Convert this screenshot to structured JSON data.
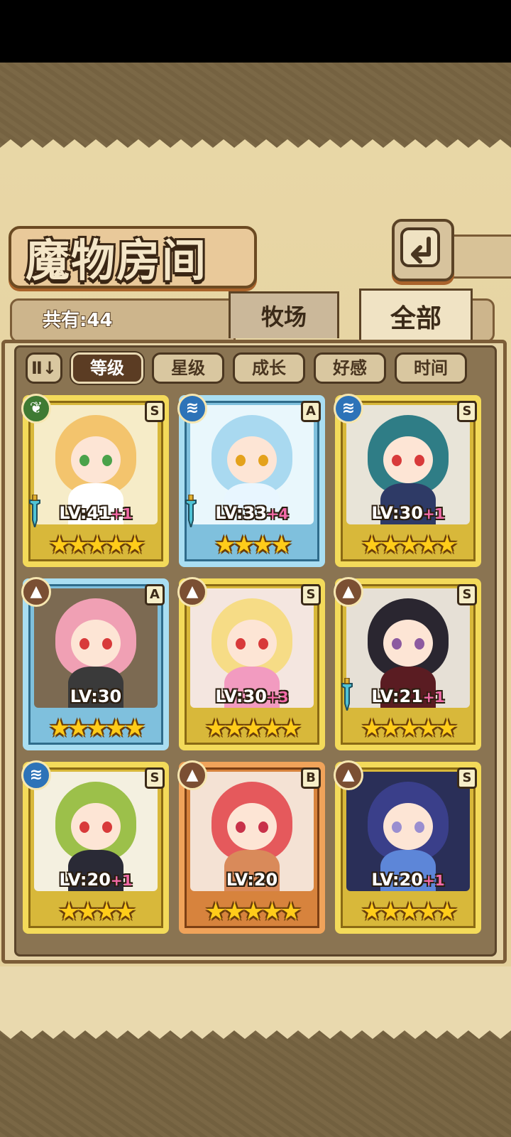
{
  "header": {
    "title": "魔物房间"
  },
  "info": {
    "count_label": "共有:44"
  },
  "tabs": [
    {
      "label": "牧场",
      "active": false
    },
    {
      "label": "全部",
      "active": true
    }
  ],
  "sort": {
    "toggle_label": "Ⅱ↓",
    "buttons": [
      {
        "label": "等级",
        "active": true
      },
      {
        "label": "星级",
        "active": false
      },
      {
        "label": "成长",
        "active": false
      },
      {
        "label": "好感",
        "active": false
      },
      {
        "label": "时间",
        "active": false
      }
    ]
  },
  "monsters": [
    {
      "level": "LV:41",
      "bonus": "+1",
      "rank": "S",
      "element": "nature-icon",
      "element_glyph": "❦",
      "stars": 5,
      "weapon": true,
      "frame": "gold",
      "hair_color": "#f3c46d",
      "eye_color": "#4aa24a",
      "outfit_color": "#ffffff",
      "bg_color": "#f6ecc8"
    },
    {
      "level": "LV:33",
      "bonus": "+4",
      "rank": "A",
      "element": "water-icon",
      "element_glyph": "≋",
      "stars": 4,
      "weapon": true,
      "frame": "blue",
      "hair_color": "#a9d9f0",
      "eye_color": "#e4a21c",
      "outfit_color": "#e8f6ff",
      "bg_color": "#e9f7fc"
    },
    {
      "level": "LV:30",
      "bonus": "+1",
      "rank": "S",
      "element": "water-icon",
      "element_glyph": "≋",
      "stars": 5,
      "weapon": false,
      "frame": "gold",
      "hair_color": "#2f7d86",
      "eye_color": "#d83a3a",
      "outfit_color": "#2e3a66",
      "bg_color": "#e8e4d8"
    },
    {
      "level": "LV:30",
      "bonus": "",
      "rank": "A",
      "element": "earth-icon",
      "element_glyph": "▲",
      "stars": 5,
      "weapon": false,
      "frame": "blue",
      "hair_color": "#f0a0b4",
      "eye_color": "#d83a3a",
      "outfit_color": "#3a3a3a",
      "bg_color": "#7c6a52"
    },
    {
      "level": "LV:30",
      "bonus": "+3",
      "rank": "S",
      "element": "earth-icon",
      "element_glyph": "▲",
      "stars": 5,
      "weapon": false,
      "frame": "gold",
      "hair_color": "#f6dc86",
      "eye_color": "#d83a3a",
      "outfit_color": "#f29bc0",
      "bg_color": "#f4e6e0"
    },
    {
      "level": "LV:21",
      "bonus": "+1",
      "rank": "S",
      "element": "earth-icon",
      "element_glyph": "▲",
      "stars": 5,
      "weapon": true,
      "frame": "gold",
      "hair_color": "#2a2630",
      "eye_color": "#8c5aa0",
      "outfit_color": "#5a1c22",
      "bg_color": "#e6e0d6"
    },
    {
      "level": "LV:20",
      "bonus": "+1",
      "rank": "S",
      "element": "water-icon",
      "element_glyph": "≋",
      "stars": 4,
      "weapon": false,
      "frame": "gold",
      "hair_color": "#9cc04a",
      "eye_color": "#d83a3a",
      "outfit_color": "#2a2a36",
      "bg_color": "#f4f0e0"
    },
    {
      "level": "LV:20",
      "bonus": "",
      "rank": "B",
      "element": "earth-icon",
      "element_glyph": "▲",
      "stars": 5,
      "weapon": false,
      "frame": "bronze",
      "hair_color": "#e5595c",
      "eye_color": "#c8324a",
      "outfit_color": "#d98a5a",
      "bg_color": "#f4e2d4"
    },
    {
      "level": "LV:20",
      "bonus": "+1",
      "rank": "S",
      "element": "earth-icon",
      "element_glyph": "▲",
      "stars": 5,
      "weapon": false,
      "frame": "gold",
      "hair_color": "#3a3f8a",
      "eye_color": "#9a8ed0",
      "outfit_color": "#5d86d8",
      "bg_color": "#2a2f58"
    }
  ],
  "colors": {
    "gold_frame": "#f3da5a",
    "blue_frame": "#a9def2",
    "bronze_frame": "#f0a35a",
    "star": "#ffcc1a",
    "bonus_text": "#f26aa8"
  }
}
